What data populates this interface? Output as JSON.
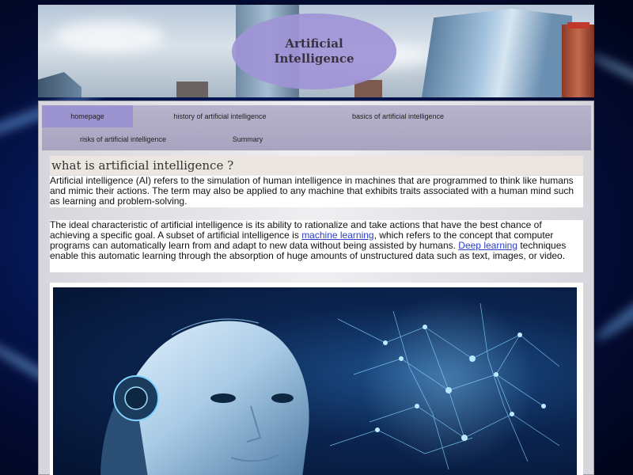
{
  "banner": {
    "title_line1": "Artificial",
    "title_line2": "Intelligence"
  },
  "nav": {
    "items": [
      {
        "label": "homepage",
        "active": true
      },
      {
        "label": "history of artificial intelligence",
        "active": false
      },
      {
        "label": "basics of artificial intelligence",
        "active": false
      },
      {
        "label": "risks of artificial intelligence",
        "active": false
      },
      {
        "label": "Summary",
        "active": false
      }
    ]
  },
  "article": {
    "heading": "what is artificial intelligence ?",
    "p1": "Artificial intelligence (AI) refers to the simulation of human intelligence in machines that are programmed to think like humans and mimic their actions. The term may also be applied to any machine that exhibits traits associated with a human mind such as learning and problem-solving.",
    "p2_a": "The ideal characteristic of artificial intelligence is its ability to rationalize and take actions that have the best chance of achieving a specific goal. A subset of artificial intelligence is ",
    "p2_link1": "machine learning",
    "p2_b": ", which refers to the concept that computer programs can automatically learn from and adapt to new data without being assisted by humans. ",
    "p2_link2": "Deep learning",
    "p2_c": " techniques enable this automatic learning through the absorption of huge amounts of unstructured data such as text, images, or video."
  },
  "colors": {
    "nav_active": "#9c94d0",
    "nav_bg": "#aaa5c1",
    "link": "#2a3ec4",
    "banner_ellipse": "#a094d7"
  },
  "icons": {
    "hero": "ai-robot-brain-image",
    "banner": "city-skyline-image"
  }
}
